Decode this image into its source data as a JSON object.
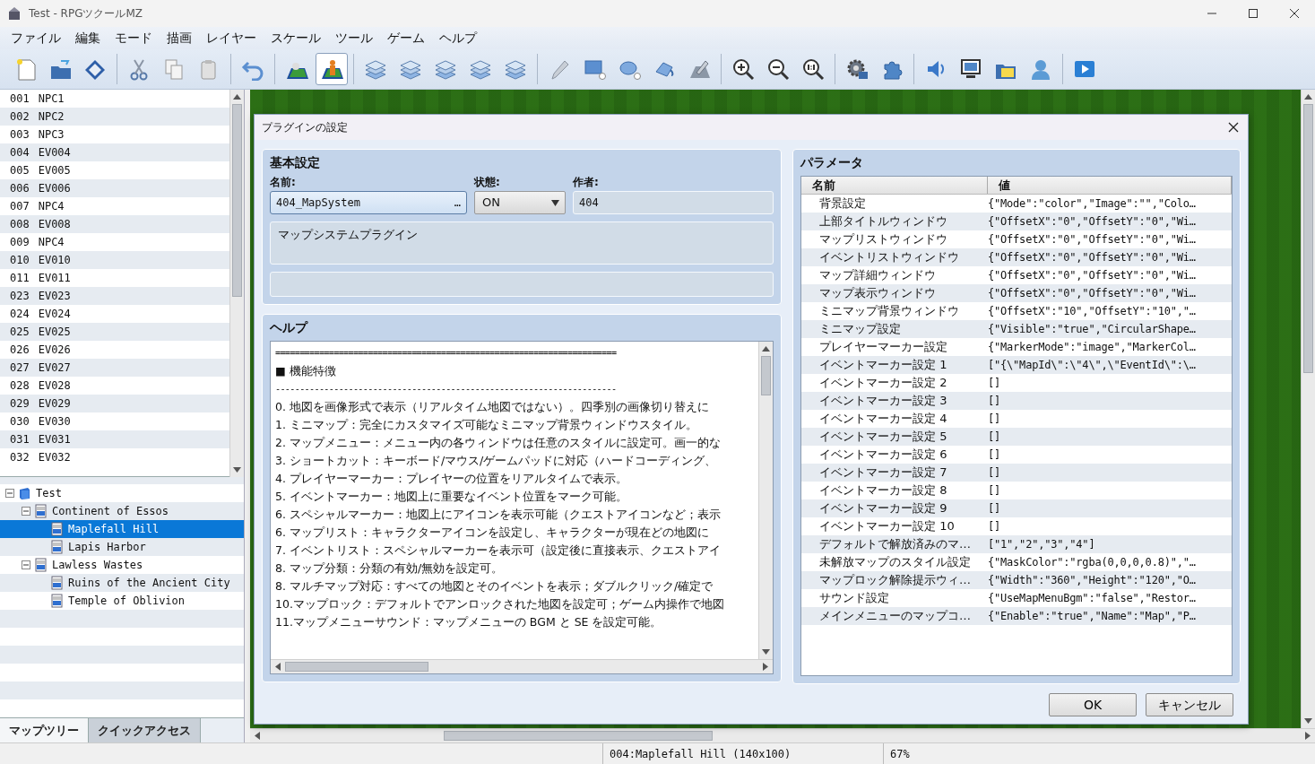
{
  "window": {
    "title": "Test - RPGツクールMZ"
  },
  "menu": [
    "ファイル",
    "編集",
    "モード",
    "描画",
    "レイヤー",
    "スケール",
    "ツール",
    "ゲーム",
    "ヘルプ"
  ],
  "toolbar": [
    {
      "kind": "new",
      "selected": false
    },
    {
      "kind": "open",
      "selected": false
    },
    {
      "kind": "save",
      "selected": false
    },
    {
      "kind": "sep"
    },
    {
      "kind": "cut",
      "selected": false
    },
    {
      "kind": "copy",
      "selected": false
    },
    {
      "kind": "paste",
      "selected": false
    },
    {
      "kind": "sep"
    },
    {
      "kind": "undo",
      "selected": false
    },
    {
      "kind": "sep"
    },
    {
      "kind": "map",
      "selected": false
    },
    {
      "kind": "event",
      "selected": true
    },
    {
      "kind": "sep"
    },
    {
      "kind": "layer",
      "selected": false
    },
    {
      "kind": "layer",
      "selected": false
    },
    {
      "kind": "layer",
      "selected": false
    },
    {
      "kind": "layer",
      "selected": false
    },
    {
      "kind": "layer",
      "selected": false
    },
    {
      "kind": "sep"
    },
    {
      "kind": "pencil",
      "selected": false
    },
    {
      "kind": "rect",
      "selected": false
    },
    {
      "kind": "ellipse",
      "selected": false
    },
    {
      "kind": "fill",
      "selected": false
    },
    {
      "kind": "shadow",
      "selected": false
    },
    {
      "kind": "sep"
    },
    {
      "kind": "zoomin",
      "selected": false
    },
    {
      "kind": "zoomout",
      "selected": false
    },
    {
      "kind": "zoomreset",
      "selected": false
    },
    {
      "kind": "sep"
    },
    {
      "kind": "gear",
      "selected": false
    },
    {
      "kind": "puzzle",
      "selected": false
    },
    {
      "kind": "sep"
    },
    {
      "kind": "speaker",
      "selected": false
    },
    {
      "kind": "monitor",
      "selected": false
    },
    {
      "kind": "folder",
      "selected": false
    },
    {
      "kind": "person",
      "selected": false
    },
    {
      "kind": "sep"
    },
    {
      "kind": "play",
      "selected": false
    }
  ],
  "event_list": [
    {
      "number": "001",
      "name": "NPC1"
    },
    {
      "number": "002",
      "name": "NPC2"
    },
    {
      "number": "003",
      "name": "NPC3"
    },
    {
      "number": "004",
      "name": "EV004"
    },
    {
      "number": "005",
      "name": "EV005"
    },
    {
      "number": "006",
      "name": "EV006"
    },
    {
      "number": "007",
      "name": "NPC4"
    },
    {
      "number": "008",
      "name": "EV008"
    },
    {
      "number": "009",
      "name": "NPC4"
    },
    {
      "number": "010",
      "name": "EV010"
    },
    {
      "number": "011",
      "name": "EV011"
    },
    {
      "number": "023",
      "name": "EV023"
    },
    {
      "number": "024",
      "name": "EV024"
    },
    {
      "number": "025",
      "name": "EV025"
    },
    {
      "number": "026",
      "name": "EV026"
    },
    {
      "number": "027",
      "name": "EV027"
    },
    {
      "number": "028",
      "name": "EV028"
    },
    {
      "number": "029",
      "name": "EV029"
    },
    {
      "number": "030",
      "name": "EV030"
    },
    {
      "number": "031",
      "name": "EV031"
    },
    {
      "number": "032",
      "name": "EV032"
    }
  ],
  "map_tree": [
    {
      "name": "Test",
      "kind": "project",
      "expanded": true,
      "selected": false,
      "children": [
        {
          "name": "Continent of Essos",
          "kind": "map",
          "expanded": true,
          "selected": false,
          "children": [
            {
              "name": "Maplefall Hill",
              "kind": "map",
              "selected": true
            },
            {
              "name": "Lapis Harbor",
              "kind": "map",
              "selected": false
            }
          ]
        },
        {
          "name": "Lawless Wastes",
          "kind": "map",
          "expanded": true,
          "selected": false,
          "children": [
            {
              "name": "Ruins of the Ancient City",
              "kind": "map",
              "selected": false
            },
            {
              "name": "Temple of Oblivion",
              "kind": "map",
              "selected": false
            }
          ]
        }
      ]
    }
  ],
  "panel_tabs": [
    {
      "label": "マップツリー",
      "selected": true
    },
    {
      "label": "クイックアクセス",
      "selected": false
    }
  ],
  "dialog": {
    "title": "プラグインの設定",
    "basic": {
      "heading": "基本設定",
      "name_label": "名前:",
      "name_value": "404_MapSystem",
      "browse": "…",
      "status_label": "状態:",
      "status_value": "ON",
      "author_label": "作者:",
      "author_value": "404",
      "description": "マップシステムプラグイン"
    },
    "help": {
      "heading": "ヘルプ",
      "lines": [
        "======================================================================",
        "■ 機能特徴",
        "----------------------------------------------------------------------",
        "0. 地図を画像形式で表示（リアルタイム地図ではない）。四季別の画像切り替えに",
        "1. ミニマップ：完全にカスタマイズ可能なミニマップ背景ウィンドウスタイル。",
        "2. マップメニュー：メニュー内の各ウィンドウは任意のスタイルに設定可。画一的な",
        "3. ショートカット：キーボード/マウス/ゲームパッドに対応（ハードコーディング、",
        "4. プレイヤーマーカー：プレイヤーの位置をリアルタイムで表示。",
        "5. イベントマーカー：地図上に重要なイベント位置をマーク可能。",
        "6. スペシャルマーカー：地図上にアイコンを表示可能（クエストアイコンなど；表示",
        "6. マップリスト：キャラクターアイコンを設定し、キャラクターが現在どの地図に",
        "7. イベントリスト：スペシャルマーカーを表示可（設定後に直接表示、クエストアイ",
        "8. マップ分類：分類の有効/無効を設定可。",
        "8. マルチマップ対応：すべての地図とそのイベントを表示；ダブルクリック/確定で",
        "10.マップロック：デフォルトでアンロックされた地図を設定可；ゲーム内操作で地図",
        "11.マップメニューサウンド：マップメニューの BGM と SE を設定可能。"
      ]
    },
    "parameters": {
      "heading": "パラメータ",
      "columns": [
        "名前",
        "値"
      ],
      "rows": [
        {
          "name": "背景設定",
          "value": "{\"Mode\":\"color\",\"Image\":\"\",\"Colo…"
        },
        {
          "name": "上部タイトルウィンドウ",
          "value": "{\"OffsetX\":\"0\",\"OffsetY\":\"0\",\"Wi…"
        },
        {
          "name": "マップリストウィンドウ",
          "value": "{\"OffsetX\":\"0\",\"OffsetY\":\"0\",\"Wi…"
        },
        {
          "name": "イベントリストウィンドウ",
          "value": "{\"OffsetX\":\"0\",\"OffsetY\":\"0\",\"Wi…"
        },
        {
          "name": "マップ詳細ウィンドウ",
          "value": "{\"OffsetX\":\"0\",\"OffsetY\":\"0\",\"Wi…"
        },
        {
          "name": "マップ表示ウィンドウ",
          "value": "{\"OffsetX\":\"0\",\"OffsetY\":\"0\",\"Wi…"
        },
        {
          "name": "ミニマップ背景ウィンドウ",
          "value": "{\"OffsetX\":\"10\",\"OffsetY\":\"10\",\"…"
        },
        {
          "name": "ミニマップ設定",
          "value": "{\"Visible\":\"true\",\"CircularShape…"
        },
        {
          "name": "プレイヤーマーカー設定",
          "value": "{\"MarkerMode\":\"image\",\"MarkerCol…"
        },
        {
          "name": "イベントマーカー設定 1",
          "value": "[\"{\\\"MapId\\\":\\\"4\\\",\\\"EventId\\\":\\…"
        },
        {
          "name": "イベントマーカー設定 2",
          "value": "[]"
        },
        {
          "name": "イベントマーカー設定 3",
          "value": "[]"
        },
        {
          "name": "イベントマーカー設定 4",
          "value": "[]"
        },
        {
          "name": "イベントマーカー設定 5",
          "value": "[]"
        },
        {
          "name": "イベントマーカー設定 6",
          "value": "[]"
        },
        {
          "name": "イベントマーカー設定 7",
          "value": "[]"
        },
        {
          "name": "イベントマーカー設定 8",
          "value": "[]"
        },
        {
          "name": "イベントマーカー設定 9",
          "value": "[]"
        },
        {
          "name": "イベントマーカー設定 10",
          "value": "[]"
        },
        {
          "name": "デフォルトで解放済みのマ…",
          "value": "[\"1\",\"2\",\"3\",\"4\"]"
        },
        {
          "name": "未解放マップのスタイル設定",
          "value": "{\"MaskColor\":\"rgba(0,0,0,0.8)\",\"…"
        },
        {
          "name": "マップロック解除提示ウィ…",
          "value": "{\"Width\":\"360\",\"Height\":\"120\",\"O…"
        },
        {
          "name": "サウンド設定",
          "value": "{\"UseMapMenuBgm\":\"false\",\"Restor…"
        },
        {
          "name": "メインメニューのマップコ…",
          "value": "{\"Enable\":\"true\",\"Name\":\"Map\",\"P…"
        }
      ]
    },
    "buttons": [
      "OK",
      "キャンセル"
    ]
  },
  "status_bar": {
    "map": "004:Maplefall Hill (140x100)",
    "zoom": "67%"
  }
}
